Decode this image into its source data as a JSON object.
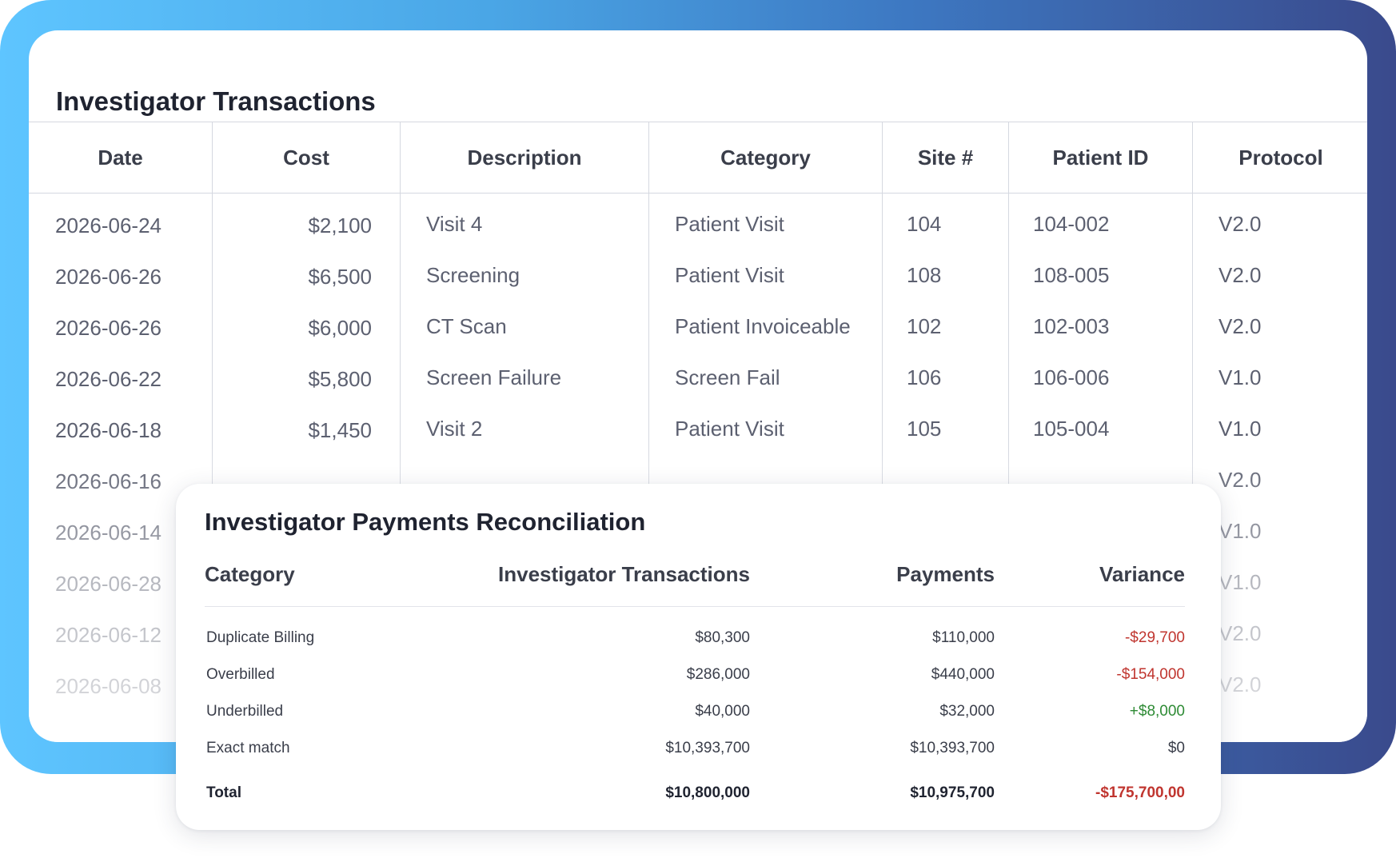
{
  "transactions": {
    "title": "Investigator Transactions",
    "columns": [
      "Date",
      "Cost",
      "Description",
      "Category",
      "Site #",
      "Patient ID",
      "Protocol"
    ],
    "rows": [
      {
        "date": "2026-06-24",
        "cost": "$2,100",
        "description": "Visit 4",
        "category": "Patient Visit",
        "site": "104",
        "patient_id": "104-002",
        "protocol": "V2.0"
      },
      {
        "date": "2026-06-26",
        "cost": "$6,500",
        "description": "Screening",
        "category": "Patient Visit",
        "site": "108",
        "patient_id": "108-005",
        "protocol": "V2.0"
      },
      {
        "date": "2026-06-26",
        "cost": "$6,000",
        "description": "CT Scan",
        "category": "Patient Invoiceable",
        "site": "102",
        "patient_id": "102-003",
        "protocol": "V2.0"
      },
      {
        "date": "2026-06-22",
        "cost": "$5,800",
        "description": "Screen Failure",
        "category": "Screen Fail",
        "site": "106",
        "patient_id": "106-006",
        "protocol": "V1.0"
      },
      {
        "date": "2026-06-18",
        "cost": "$1,450",
        "description": "Visit 2",
        "category": "Patient Visit",
        "site": "105",
        "patient_id": "105-004",
        "protocol": "V1.0"
      },
      {
        "date": "2026-06-16",
        "protocol": "V2.0"
      },
      {
        "date": "2026-06-14",
        "protocol": "V1.0"
      },
      {
        "date": "2026-06-28",
        "protocol": "V1.0"
      },
      {
        "date": "2026-06-12",
        "protocol": "V2.0"
      },
      {
        "date": "2026-06-08",
        "protocol": "V2.0"
      }
    ]
  },
  "reconciliation": {
    "title": "Investigator Payments Reconciliation",
    "columns": [
      "Category",
      "Investigator Transactions",
      "Payments",
      "Variance"
    ],
    "rows": [
      {
        "category": "Duplicate Billing",
        "transactions": "$80,300",
        "payments": "$110,000",
        "variance": "-$29,700",
        "tone": "neg"
      },
      {
        "category": "Overbilled",
        "transactions": "$286,000",
        "payments": "$440,000",
        "variance": "-$154,000",
        "tone": "neg"
      },
      {
        "category": "Underbilled",
        "transactions": "$40,000",
        "payments": "$32,000",
        "variance": "+$8,000",
        "tone": "pos"
      },
      {
        "category": "Exact match",
        "transactions": "$10,393,700",
        "payments": "$10,393,700",
        "variance": "$0",
        "tone": "neutral"
      }
    ],
    "total": {
      "label": "Total",
      "transactions": "$10,800,000",
      "payments": "$10,975,700",
      "variance": "-$175,700,00",
      "tone": "neg"
    }
  },
  "colors": {
    "negative": "#c0352f",
    "positive": "#2e8b35",
    "gradient_start": "#5ec5ff",
    "gradient_end": "#3a4a8c"
  }
}
